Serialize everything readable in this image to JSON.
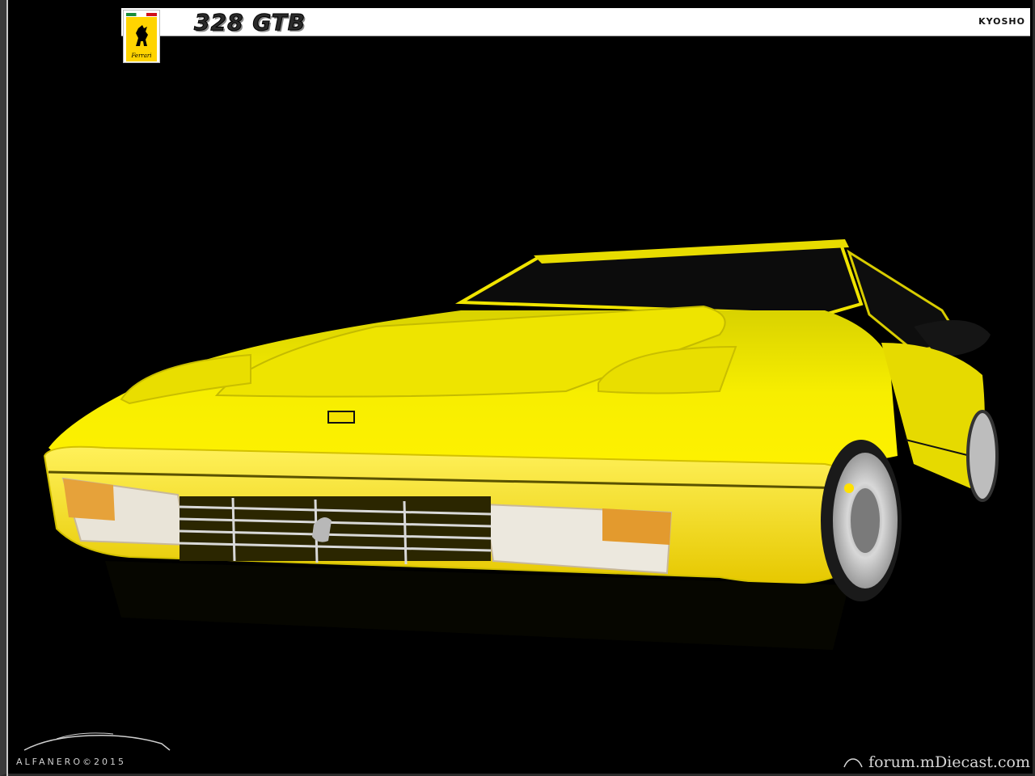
{
  "header": {
    "model": "328 GTB",
    "maker": "KYOSHO",
    "badge_word": "Ferrari"
  },
  "signature": {
    "text": "ALFANERO©2015"
  },
  "watermark": {
    "text": "forum.mDiecast.com"
  },
  "colors": {
    "car_body": "#f5e600",
    "background": "#000000",
    "header": "#ffffff",
    "badge_yellow": "#ffd400"
  }
}
